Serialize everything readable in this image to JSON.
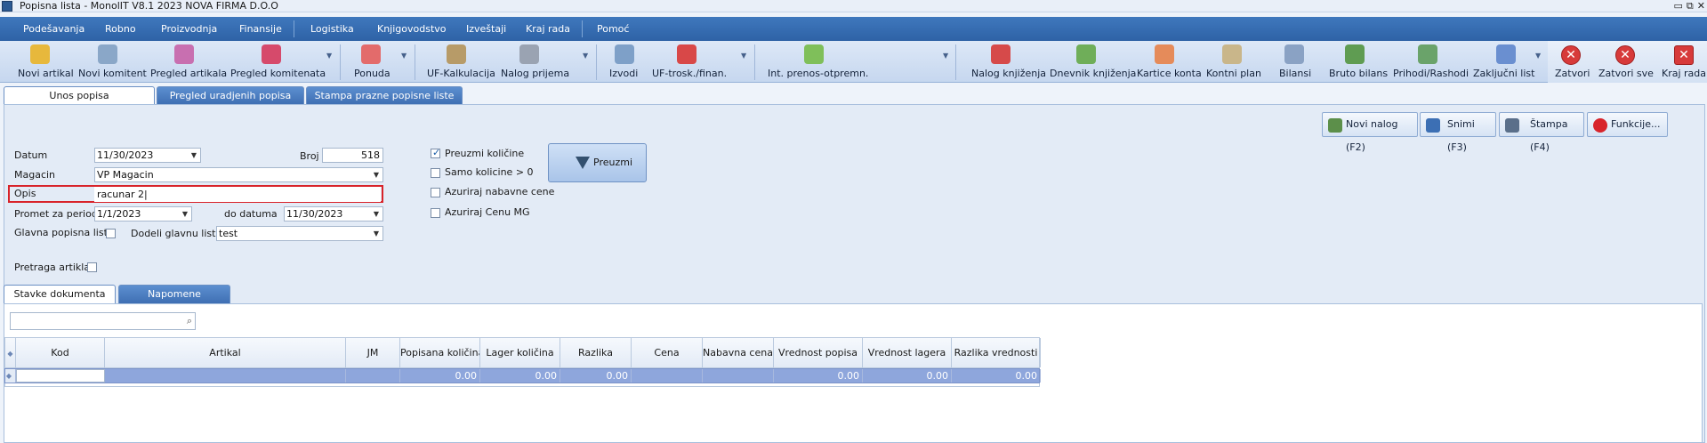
{
  "window": {
    "title": "Popisna lista - MonolIT V8.1 2023 NOVA FIRMA D.O.O",
    "controls": [
      "▭",
      "⧉",
      "✕"
    ]
  },
  "menu": [
    "Podešavanja",
    "Robno",
    "Proizvodnja",
    "Finansije",
    "Logistika",
    "Knjigovodstvo",
    "Izveštaji",
    "Kraj rada",
    "Pomoć"
  ],
  "toolbar": [
    {
      "label": "Novi artikal",
      "icon": "new-item-icon",
      "color": "#e7b83c"
    },
    {
      "label": "Novi komitent",
      "icon": "new-partner-icon",
      "color": "#8aa7c8"
    },
    {
      "label": "Pregled artikala",
      "icon": "items-list-icon",
      "color": "#c86fb0"
    },
    {
      "label": "Pregled komitenata",
      "icon": "partners-list-icon",
      "color": "#d64a6b"
    },
    {
      "label": "Ponuda",
      "icon": "offer-icon",
      "color": "#e36b6b"
    },
    {
      "label": "UF-Kalkulacija",
      "icon": "calculation-icon",
      "color": "#b79b68"
    },
    {
      "label": "Nalog prijema",
      "icon": "receipt-order-icon",
      "color": "#9aa3b2"
    },
    {
      "label": "Izvodi",
      "icon": "statements-icon",
      "color": "#7ea0c8"
    },
    {
      "label": "UF-trosk./finan.",
      "icon": "costs-icon",
      "color": "#d84848"
    },
    {
      "label": "Int. prenos-otpremn.",
      "icon": "transfer-icon",
      "color": "#7fbf5a"
    },
    {
      "label": "Nalog knjiženja",
      "icon": "posting-order-icon",
      "color": "#d64a4a"
    },
    {
      "label": "Dnevnik knjiženja",
      "icon": "journal-icon",
      "color": "#6fae59"
    },
    {
      "label": "Kartice konta",
      "icon": "account-cards-icon",
      "color": "#e58b5a"
    },
    {
      "label": "Kontni plan",
      "icon": "chart-of-accounts-icon",
      "color": "#c9b68a"
    },
    {
      "label": "Bilansi",
      "icon": "balance-icon",
      "color": "#8aa2c4"
    },
    {
      "label": "Bruto bilans",
      "icon": "gross-balance-icon",
      "color": "#5f9c52"
    },
    {
      "label": "Prihodi/Rashodi",
      "icon": "income-expense-icon",
      "color": "#6aa36a"
    },
    {
      "label": "Zaključni list",
      "icon": "closing-sheet-icon",
      "color": "#6a8fd0"
    }
  ],
  "right_buttons": [
    {
      "label": "Zatvori",
      "icon": "close-icon"
    },
    {
      "label": "Zatvori sve",
      "icon": "close-all-icon"
    },
    {
      "label": "Kraj rada",
      "icon": "exit-icon"
    }
  ],
  "tabs": [
    "Unos popisa",
    "Pregled uradjenih popisa",
    "Stampa prazne popisne liste"
  ],
  "actions": [
    {
      "label": "Novi nalog (F2)",
      "icon": "new-document-icon",
      "color": "#5c8f4a"
    },
    {
      "label": "Snimi (F3)",
      "icon": "save-icon",
      "color": "#3c6fb4"
    },
    {
      "label": "Štampa (F4)",
      "icon": "print-icon",
      "color": "#5a6f8a"
    },
    {
      "label": "Funkcije...",
      "icon": "functions-icon",
      "color": "#d8232a"
    }
  ],
  "form": {
    "datum_label": "Datum",
    "datum_value": "11/30/2023",
    "broj_label": "Broj",
    "broj_value": "518",
    "magacin_label": "Magacin",
    "magacin_value": "VP Magacin",
    "opis_label": "Opis",
    "opis_value": "racunar 2",
    "promet_label": "Promet za period",
    "promet_od": "1/1/2023",
    "do_label": "do datuma",
    "promet_do": "11/30/2023",
    "glavna_label": "Glavna popisna lista",
    "dodeli_label": "Dodeli glavnu listu",
    "dodeli_value": "test",
    "pretraga_label": "Pretraga artikla"
  },
  "options": [
    {
      "label": "Preuzmi količine",
      "checked": true
    },
    {
      "label": "Samo kolicine > 0",
      "checked": false
    },
    {
      "label": "Azuriraj nabavne cene",
      "checked": false
    },
    {
      "label": "Azuriraj Cenu MG",
      "checked": false
    }
  ],
  "preuzmi_label": "Preuzmi",
  "subtabs": [
    "Stavke dokumenta",
    "Napomene"
  ],
  "grid": {
    "columns": [
      "Kod",
      "Artikal",
      "JM",
      "Popisana količina",
      "Lager količina",
      "Razlika",
      "Cena",
      "Nabavna cena",
      "Vrednost popisa",
      "Vrednost lagera",
      "Razlika vrednosti"
    ],
    "row": [
      "",
      "",
      "",
      "0.00",
      "0.00",
      "0.00",
      "",
      "",
      "0.00",
      "0.00",
      "0.00"
    ]
  }
}
